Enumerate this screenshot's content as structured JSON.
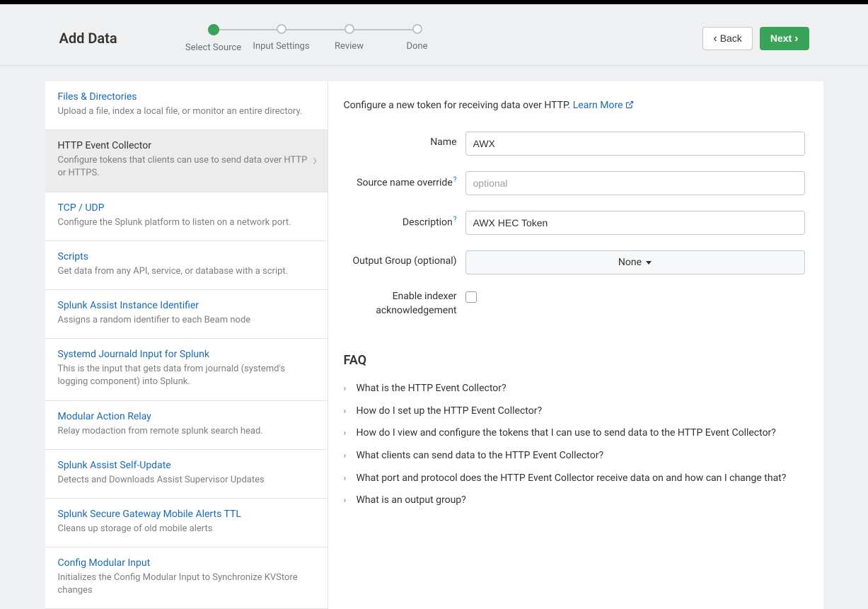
{
  "header": {
    "title": "Add Data",
    "steps": [
      "Select Source",
      "Input Settings",
      "Review",
      "Done"
    ],
    "activeStep": 0,
    "backLabel": "Back",
    "nextLabel": "Next"
  },
  "sidebar": {
    "items": [
      {
        "title": "Files & Directories",
        "desc": "Upload a file, index a local file, or monitor an entire directory."
      },
      {
        "title": "HTTP Event Collector",
        "desc": "Configure tokens that clients can use to send data over HTTP or HTTPS.",
        "selected": true
      },
      {
        "title": "TCP / UDP",
        "desc": "Configure the Splunk platform to listen on a network port."
      },
      {
        "title": "Scripts",
        "desc": "Get data from any API, service, or database with a script."
      },
      {
        "title": "Splunk Assist Instance Identifier",
        "desc": "Assigns a random identifier to each Beam node"
      },
      {
        "title": "Systemd Journald Input for Splunk",
        "desc": "This is the input that gets data from journald (systemd's logging component) into Splunk."
      },
      {
        "title": "Modular Action Relay",
        "desc": "Relay modaction from remote splunk search head."
      },
      {
        "title": "Splunk Assist Self-Update",
        "desc": "Detects and Downloads Assist Supervisor Updates"
      },
      {
        "title": "Splunk Secure Gateway Mobile Alerts TTL",
        "desc": "Cleans up storage of old mobile alerts"
      },
      {
        "title": "Config Modular Input",
        "desc": "Initializes the Config Modular Input to Synchronize KVStore changes"
      }
    ]
  },
  "main": {
    "introText": "Configure a new token for receiving data over HTTP. ",
    "learnMore": "Learn More",
    "form": {
      "nameLabel": "Name",
      "nameValue": "AWX",
      "sourceLabel": "Source name override",
      "sourcePlaceholder": "optional",
      "descLabel": "Description",
      "descValue": "AWX HEC Token",
      "outputLabel": "Output Group (optional)",
      "outputValue": "None",
      "ackLabel": "Enable indexer acknowledgement"
    },
    "faq": {
      "title": "FAQ",
      "items": [
        "What is the HTTP Event Collector?",
        "How do I set up the HTTP Event Collector?",
        "How do I view and configure the tokens that I can use to send data to the HTTP Event Collector?",
        "What clients can send data to the HTTP Event Collector?",
        "What port and protocol does the HTTP Event Collector receive data on and how can I change that?",
        "What is an output group?"
      ]
    }
  }
}
